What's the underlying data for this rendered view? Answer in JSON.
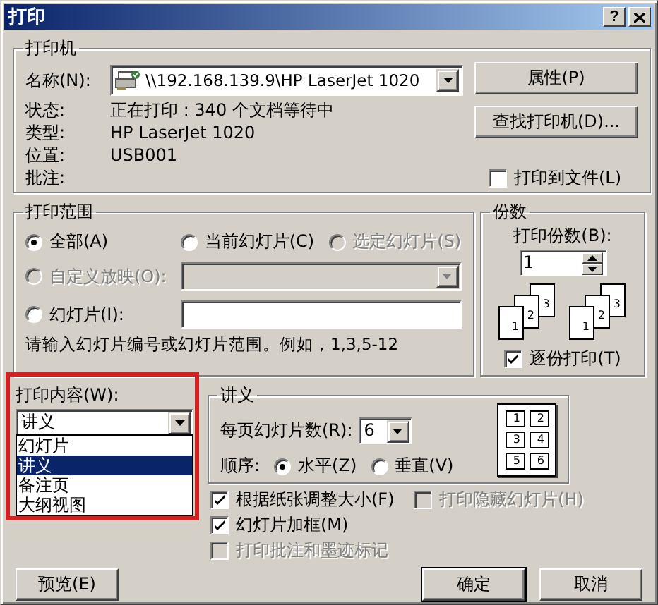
{
  "window": {
    "title": "打印",
    "help_button": "?"
  },
  "printer": {
    "title": "打印机",
    "name_label": "名称(N):",
    "name_value": "\\\\192.168.139.9\\HP LaserJet 1020",
    "info": [
      {
        "label": "状态:",
        "value": "正在打印 : 340 个文档等待中"
      },
      {
        "label": "类型:",
        "value": "HP LaserJet 1020"
      },
      {
        "label": "位置:",
        "value": "USB001"
      },
      {
        "label": "批注:"
      }
    ],
    "properties_button": "属性(P)",
    "find_button": "查找打印机(D)...",
    "print_to_file": {
      "label": "打印到文件(L)",
      "checked": false
    }
  },
  "range": {
    "title": "打印范围",
    "options": [
      {
        "label": "全部(A)",
        "selected": true,
        "disabled": false
      },
      {
        "label": "当前幻灯片(C)",
        "selected": false,
        "disabled": false
      },
      {
        "label": "选定幻灯片(S)",
        "selected": false,
        "disabled": true
      },
      {
        "label": "自定义放映(O):",
        "selected": false,
        "disabled": true
      },
      {
        "label": "幻灯片(I):",
        "selected": false,
        "disabled": false
      }
    ],
    "hint": "请输入幻灯片编号或幻灯片范围。例如，1,3,5-12"
  },
  "copies": {
    "title": "份数",
    "count_label": "打印份数(B):",
    "count_value": "1",
    "collate_stacks": [
      [
        "1",
        "2",
        "3"
      ],
      [
        "1",
        "2",
        "3"
      ]
    ],
    "collate": {
      "label": "逐份打印(T)",
      "checked": true
    }
  },
  "print_what": {
    "label": "打印内容(W):",
    "value": "讲义",
    "highlighted": true,
    "options": [
      {
        "label": "幻灯片",
        "selected": false
      },
      {
        "label": "讲义",
        "selected": true
      },
      {
        "label": "备注页",
        "selected": false
      },
      {
        "label": "大纲视图",
        "selected": false
      }
    ]
  },
  "handouts": {
    "title": "讲义",
    "per_page_label": "每页幻灯片数(R):",
    "per_page_value": "6",
    "order_label": "顺序:",
    "order": [
      {
        "label": "水平(Z)",
        "selected": true
      },
      {
        "label": "垂直(V)",
        "selected": false
      }
    ],
    "preview_numbers": [
      "1",
      "2",
      "3",
      "4",
      "5",
      "6"
    ]
  },
  "options": [
    {
      "label": "根据纸张调整大小(F)",
      "checked": true,
      "disabled": false
    },
    {
      "label": "打印隐藏幻灯片(H)",
      "checked": false,
      "disabled": true
    },
    {
      "label": "幻灯片加框(M)",
      "checked": true,
      "disabled": false
    },
    {
      "label": "打印批注和墨迹标记",
      "checked": false,
      "disabled": true
    }
  ],
  "buttons": [
    {
      "label": "预览(E)",
      "default": false
    },
    {
      "label": "确定",
      "default": true
    },
    {
      "label": "取消",
      "default": false
    }
  ]
}
